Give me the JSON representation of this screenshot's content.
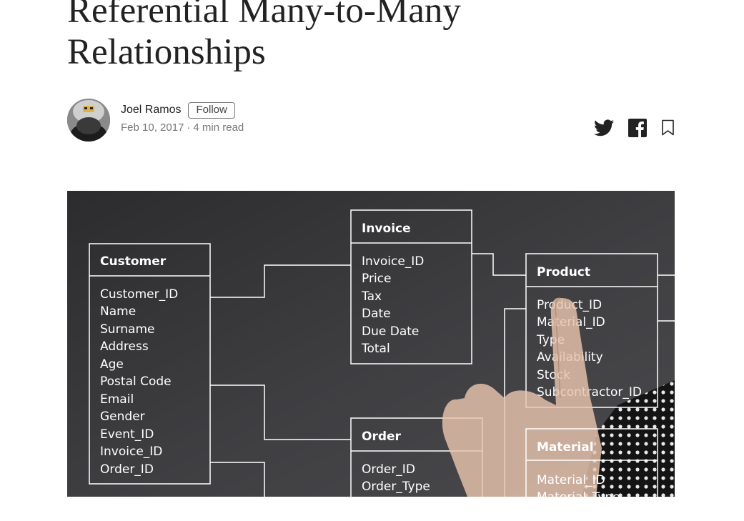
{
  "article": {
    "title": "Referential Many-to-Many Relationships"
  },
  "author": {
    "name": "Joel Ramos",
    "follow_label": "Follow",
    "date": "Feb 10, 2017",
    "separator": "·",
    "read_time": "4 min read"
  },
  "share": {
    "icons": [
      "twitter-icon",
      "facebook-icon",
      "bookmark-icon"
    ]
  },
  "hero_image": {
    "tables": {
      "customer": {
        "name": "Customer",
        "fields": [
          "Customer_ID",
          "Name",
          "Surname",
          "Address",
          "Age",
          "Postal Code",
          "Email",
          "Gender",
          "Event_ID",
          "Invoice_ID",
          "Order_ID"
        ]
      },
      "invoice": {
        "name": "Invoice",
        "fields": [
          "Invoice_ID",
          "Price",
          "Tax",
          "Date",
          "Due Date",
          "Total"
        ]
      },
      "order": {
        "name": "Order",
        "fields": [
          "Order_ID",
          "Order_Type"
        ]
      },
      "product": {
        "name": "Product",
        "fields": [
          "Product_ID",
          "Material_ID",
          "Type",
          "Availability",
          "Stock",
          "Subcontractor_ID"
        ]
      },
      "material": {
        "name": "Material",
        "fields": [
          "Material_ID",
          "Material_Type"
        ]
      }
    }
  },
  "colors": {
    "text": "#222222",
    "muted": "#777777",
    "hero_bg": "#3d3d3f",
    "diagram_line": "#ffffff"
  }
}
